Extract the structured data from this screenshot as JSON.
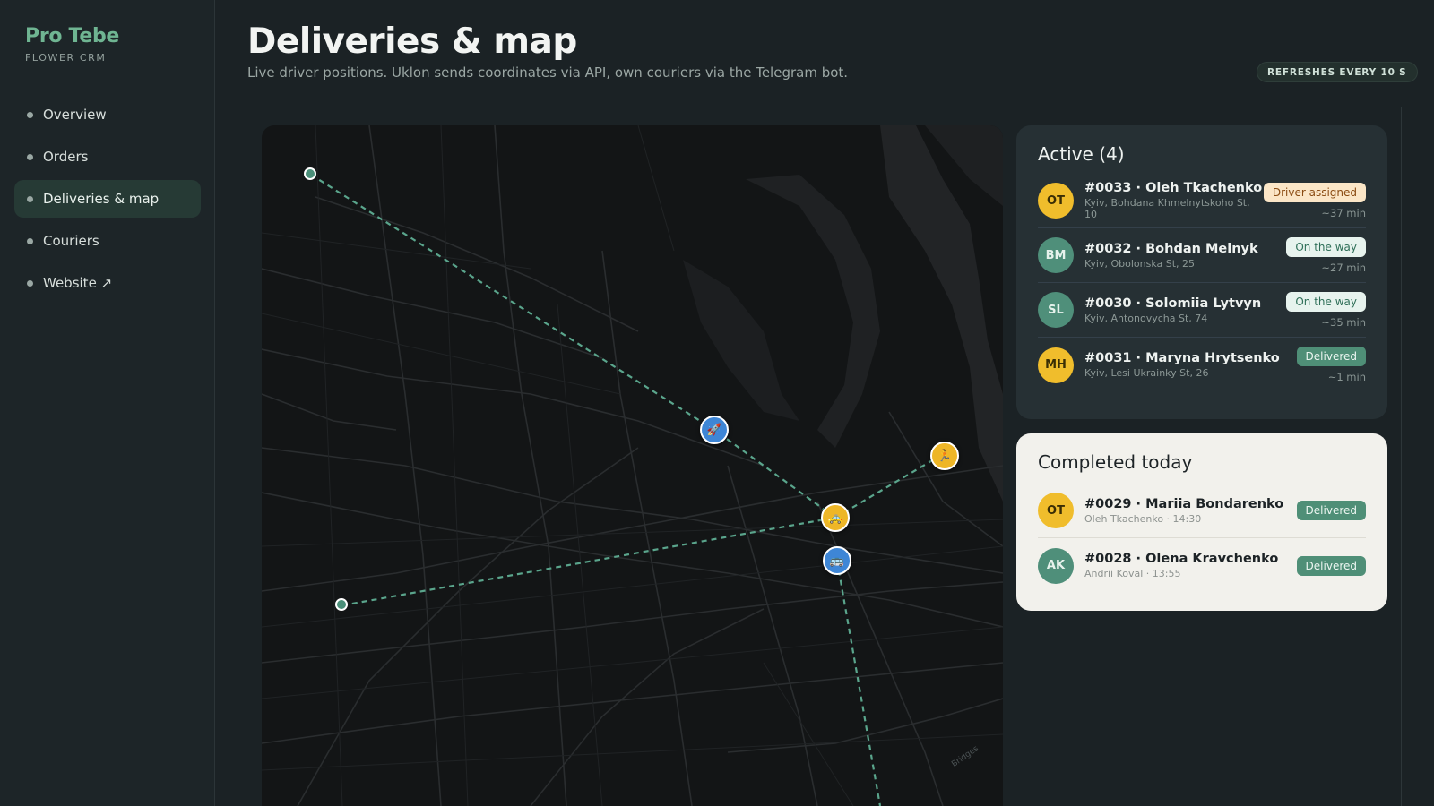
{
  "brand": {
    "name": "Pro Tebe",
    "subtitle": "FLOWER CRM"
  },
  "nav": [
    {
      "label": "Overview",
      "active": false
    },
    {
      "label": "Orders",
      "active": false
    },
    {
      "label": "Deliveries & map",
      "active": true
    },
    {
      "label": "Couriers",
      "active": false
    },
    {
      "label": "Website ↗",
      "active": false
    }
  ],
  "header": {
    "title": "Deliveries & map",
    "subtitle": "Live driver positions. Uklon sends coordinates via API, own couriers via the Telegram bot.",
    "refresh_badge": "REFRESHES EVERY 10 S"
  },
  "map": {
    "markers": [
      {
        "icon": "rocket-icon",
        "glyph": "🚀",
        "color": "blue"
      },
      {
        "icon": "runner-icon",
        "glyph": "🏃",
        "color": "yellow"
      },
      {
        "icon": "taxi-icon",
        "glyph": "🚕",
        "color": "yellow"
      },
      {
        "icon": "bus-icon",
        "glyph": "🚌",
        "color": "blue"
      }
    ],
    "attribution": "Bridges"
  },
  "active": {
    "title": "Active (4)",
    "rows": [
      {
        "initials": "OT",
        "avatar": "y",
        "title": "#0033 · Oleh Tkachenko",
        "address": "Kyiv, Bohdana Khmelnytskoho St, 10",
        "status": "Driver assigned",
        "status_kind": "assigned",
        "eta": "~37 min"
      },
      {
        "initials": "BM",
        "avatar": "g",
        "title": "#0032 · Bohdan Melnyk",
        "address": "Kyiv, Obolonska St, 25",
        "status": "On the way",
        "status_kind": "way",
        "eta": "~27 min"
      },
      {
        "initials": "SL",
        "avatar": "g",
        "title": "#0030 · Solomiia Lytvyn",
        "address": "Kyiv, Antonovycha St, 74",
        "status": "On the way",
        "status_kind": "way",
        "eta": "~35 min"
      },
      {
        "initials": "MH",
        "avatar": "y",
        "title": "#0031 · Maryna Hrytsenko",
        "address": "Kyiv, Lesi Ukrainky St, 26",
        "status": "Delivered",
        "status_kind": "done",
        "eta": "~1 min"
      }
    ]
  },
  "completed": {
    "title": "Completed today",
    "rows": [
      {
        "initials": "OT",
        "avatar": "y",
        "title": "#0029 · Mariia Bondarenko",
        "sub": "Oleh Tkachenko · 14:30",
        "status": "Delivered",
        "status_kind": "done"
      },
      {
        "initials": "AK",
        "avatar": "g",
        "title": "#0028 · Olena Kravchenko",
        "sub": "Andrii Koval · 13:55",
        "status": "Delivered",
        "status_kind": "done"
      }
    ]
  }
}
